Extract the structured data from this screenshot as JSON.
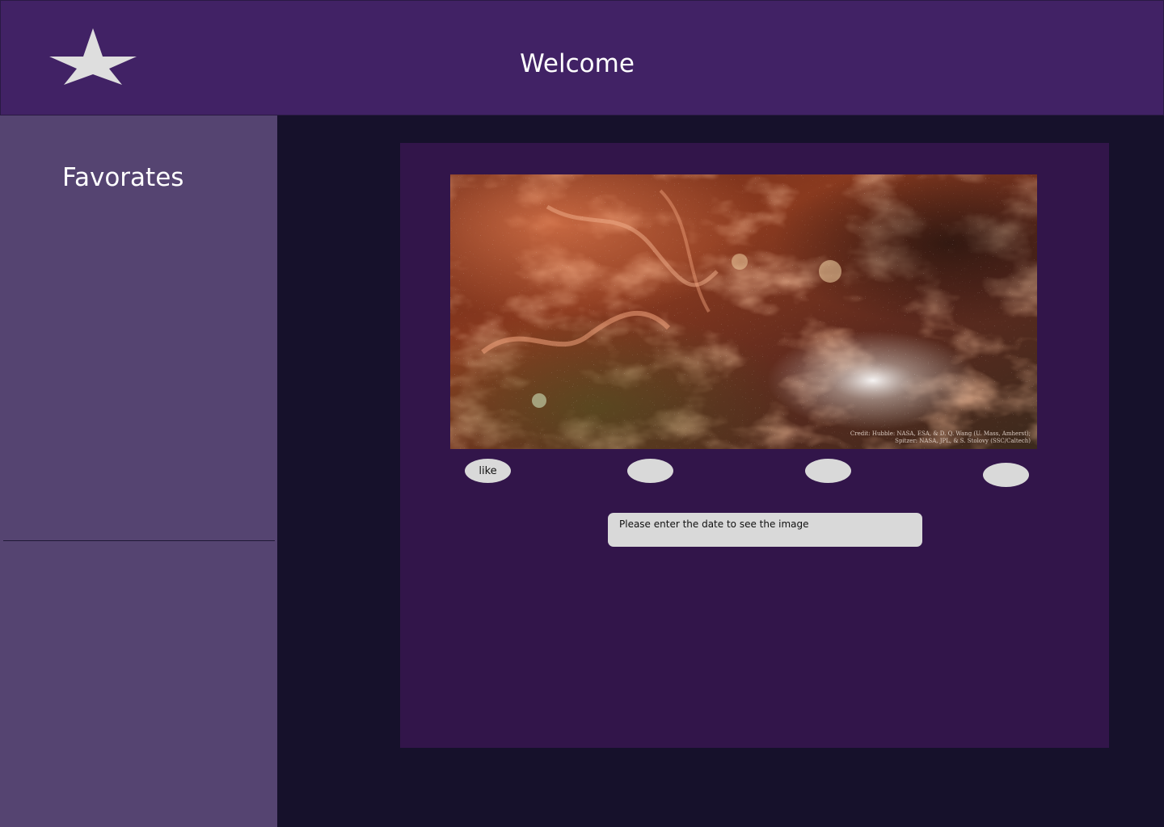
{
  "header": {
    "logo_icon": "star-icon",
    "title": "Welcome"
  },
  "sidebar": {
    "title": "Favorates"
  },
  "main": {
    "image": {
      "credit_line_1": "Credit: Hubble: NASA, ESA, & D. Q. Wang (U. Mass, Amherst);",
      "credit_line_2": "Spitzer: NASA, JPL, & S. Stolovy (SSC/Caltech)"
    },
    "actions": [
      {
        "label": "like"
      },
      {
        "label": ""
      },
      {
        "label": ""
      },
      {
        "label": ""
      }
    ],
    "date_input": {
      "value": "Please enter the date to see the image"
    }
  },
  "colors": {
    "header_bg": "#412265",
    "sidebar_bg": "#554471",
    "page_bg": "#16112b",
    "card_bg": "#32154a",
    "control_bg": "#d9d9d9"
  }
}
